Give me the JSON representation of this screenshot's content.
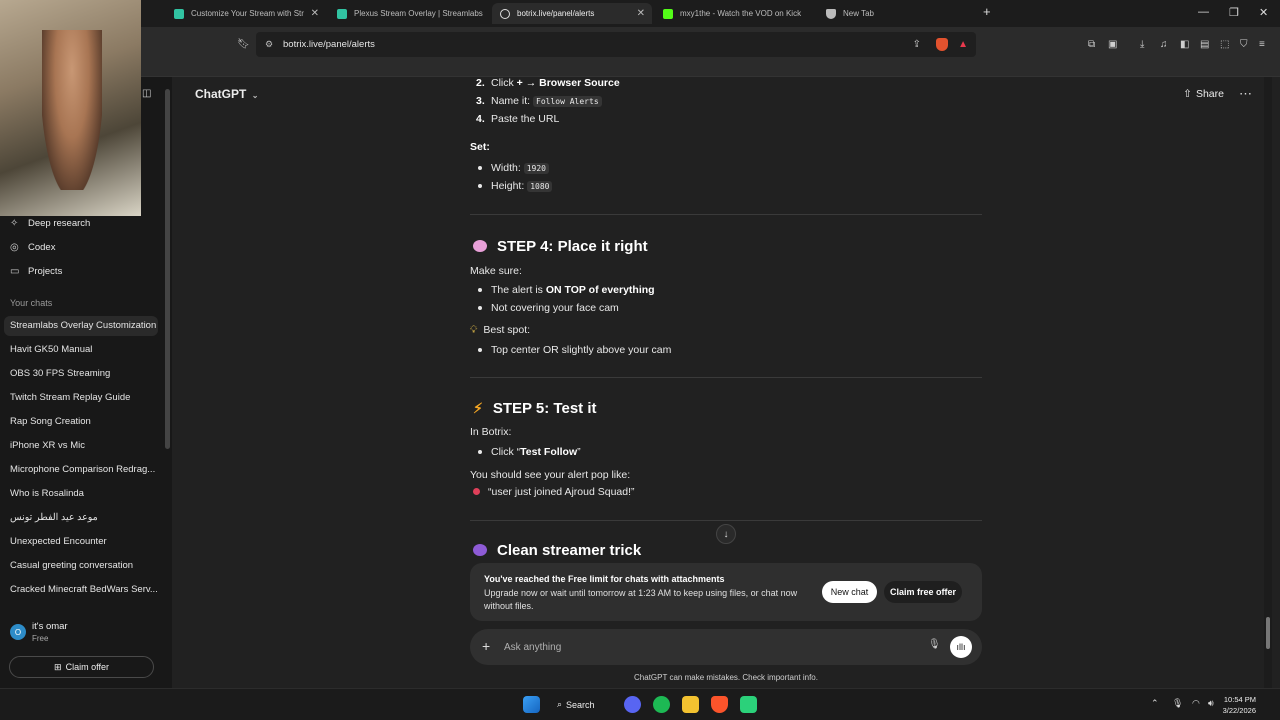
{
  "browser": {
    "tabs": [
      {
        "title": "Customize Your Stream with Str",
        "fav_color": "#31c3a2",
        "active": false
      },
      {
        "title": "Plexus Stream Overlay | Streamlabs",
        "fav_color": "#31c3a2",
        "active": false
      },
      {
        "title": "botrix.live/panel/alerts",
        "fav_color": "#dddddd",
        "active": true
      },
      {
        "title": "mxy1the - Watch the VOD on Kick",
        "fav_color": "#53fc18",
        "active": false
      },
      {
        "title": "New Tab",
        "fav_color": "#bbbbbb",
        "active": false
      }
    ],
    "url": "botrix.live/panel/alerts"
  },
  "sidebar": {
    "top_items": [
      {
        "label": "Deep research",
        "icon": "telescope-icon"
      },
      {
        "label": "Codex",
        "icon": "codex-icon"
      },
      {
        "label": "Projects",
        "icon": "folder-icon"
      }
    ],
    "section_label": "Your chats",
    "chats": [
      "Streamlabs Overlay Customization",
      "Havit GK50 Manual",
      "OBS 30 FPS Streaming",
      "Twitch Stream Replay Guide",
      "Rap Song Creation",
      "iPhone XR vs Mic",
      "Microphone Comparison Redrag...",
      "Who is Rosalinda",
      "موعد عيد الفطر تونس",
      "Unexpected Encounter",
      "Casual greeting conversation",
      "Cracked Minecraft BedWars Serv..."
    ],
    "user": {
      "name": "it's omar",
      "plan": "Free",
      "initial": "O"
    },
    "claim_offer": "Claim offer"
  },
  "header": {
    "title": "ChatGPT",
    "share": "Share"
  },
  "content": {
    "steps_list": [
      {
        "num": "2.",
        "pre": "Click ",
        "bold": "+ → Browser Source"
      },
      {
        "num": "3.",
        "pre": "Name it: ",
        "code": "Follow Alerts"
      },
      {
        "num": "4.",
        "pre": "Paste the URL"
      }
    ],
    "set_label": "Set:",
    "set_items": [
      {
        "label": "Width: ",
        "code": "1920"
      },
      {
        "label": "Height: ",
        "code": "1080"
      }
    ],
    "step4": {
      "title": "STEP 4: Place it right",
      "intro": "Make sure:",
      "b1_pre": "The alert is ",
      "b1_bold": "ON TOP of everything",
      "b2": "Not covering your face cam",
      "best_spot": "Best spot:",
      "b3": "Top center OR slightly above your cam"
    },
    "step5": {
      "title": "STEP 5: Test it",
      "intro": "In Botrix:",
      "b1_pre": "Click “",
      "b1_bold": "Test Follow",
      "b1_post": "”",
      "see": "You should see your alert pop like:",
      "example": "“user just joined Ajroud Squad!”"
    },
    "next_title": "Clean streamer trick"
  },
  "limit_banner": {
    "head": "You've reached the Free limit for chats with attachments",
    "body": "Upgrade now or wait until tomorrow at 1:23 AM to keep using files, or chat now without files.",
    "new_chat": "New chat",
    "claim": "Claim free offer"
  },
  "composer": {
    "placeholder": "Ask anything"
  },
  "disclaimer": "ChatGPT can make mistakes. Check important info.",
  "taskbar": {
    "search": "Search",
    "time": "10:54 PM",
    "date": "3/22/2026"
  },
  "colors": {
    "accent_bg": "#212121",
    "sidebar_bg": "#181818"
  }
}
